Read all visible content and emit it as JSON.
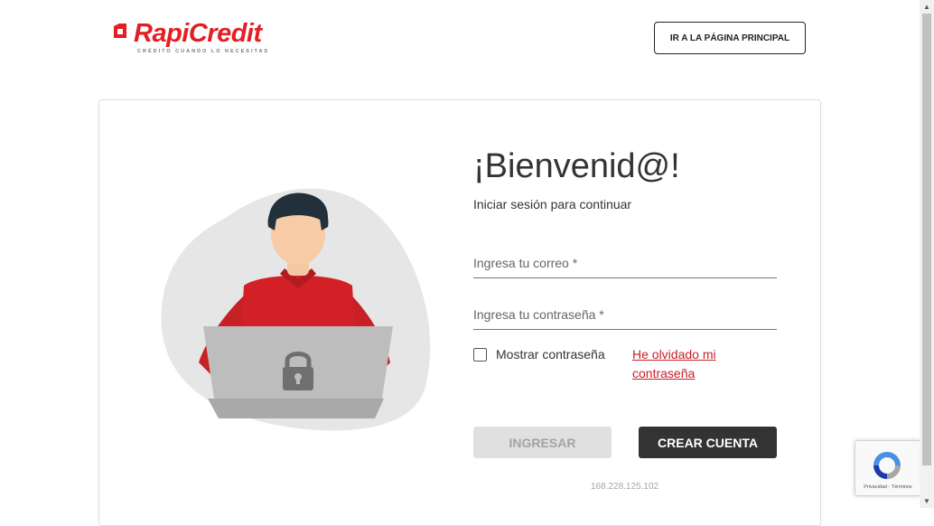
{
  "header": {
    "logo_text": "RapiCredit",
    "logo_tagline": "CRÉDITO CUANDO LO NECESITAS",
    "home_button_label": "IR A LA PÁGINA PRINCIPAL"
  },
  "login": {
    "title": "¡Bienvenid@!",
    "subtitle": "Iniciar sesión para continuar",
    "email_placeholder": "Ingresa tu correo *",
    "email_value": "",
    "password_placeholder": "Ingresa tu contraseña *",
    "password_value": "",
    "show_password_label": "Mostrar contraseña",
    "show_password_checked": false,
    "forgot_password_label": "He olvidado mi contraseña",
    "login_button_label": "INGRESAR",
    "create_account_label": "CREAR CUENTA",
    "ip_address": "168.228.125.102"
  },
  "recaptcha": {
    "footer_text": "Privacidad - Términos",
    "icon": "recaptcha-icon"
  },
  "colors": {
    "brand_red": "#e31e24",
    "link_red": "#c8202b",
    "dark_button": "#333333",
    "disabled_button": "#e0e0e0"
  },
  "icons": {
    "logo_mark": "logo-mark-icon",
    "lock": "lock-icon",
    "checkbox": "checkbox-icon"
  }
}
